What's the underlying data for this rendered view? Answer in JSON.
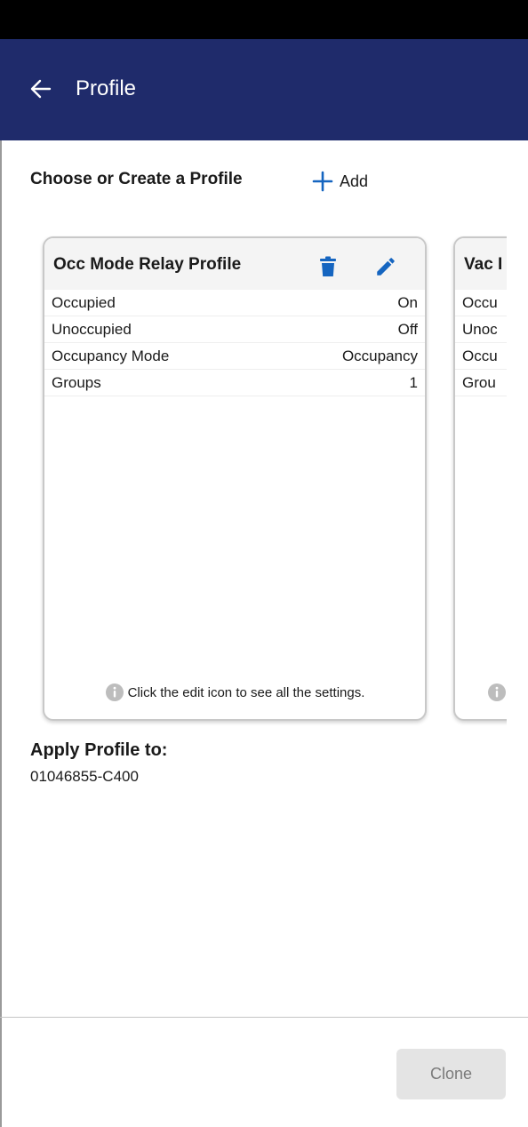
{
  "app_bar": {
    "title": "Profile",
    "background": "#1f2b6b",
    "back_icon": "arrow-left-icon"
  },
  "section": {
    "heading": "Choose or Create a Profile",
    "add_label": "Add",
    "add_icon": "plus-icon",
    "accent": "#1565c0"
  },
  "profiles": [
    {
      "name": "Occ Mode Relay Profile",
      "delete_icon": "trash-icon",
      "edit_icon": "pencil-icon",
      "rows": [
        {
          "label": "Occupied",
          "value": "On"
        },
        {
          "label": "Unoccupied",
          "value": "Off"
        },
        {
          "label": "Occupancy Mode",
          "value": "Occupancy"
        },
        {
          "label": "Groups",
          "value": "1"
        }
      ],
      "footer": "Click the edit icon to see all the settings."
    },
    {
      "name": "Vac I",
      "rows": [
        {
          "label": "Occu"
        },
        {
          "label": "Unoc"
        },
        {
          "label": "Occu"
        },
        {
          "label": "Grou"
        }
      ]
    }
  ],
  "apply": {
    "heading": "Apply Profile to:",
    "device": "01046855-C400"
  },
  "footer_bar": {
    "clone_label": "Clone"
  }
}
